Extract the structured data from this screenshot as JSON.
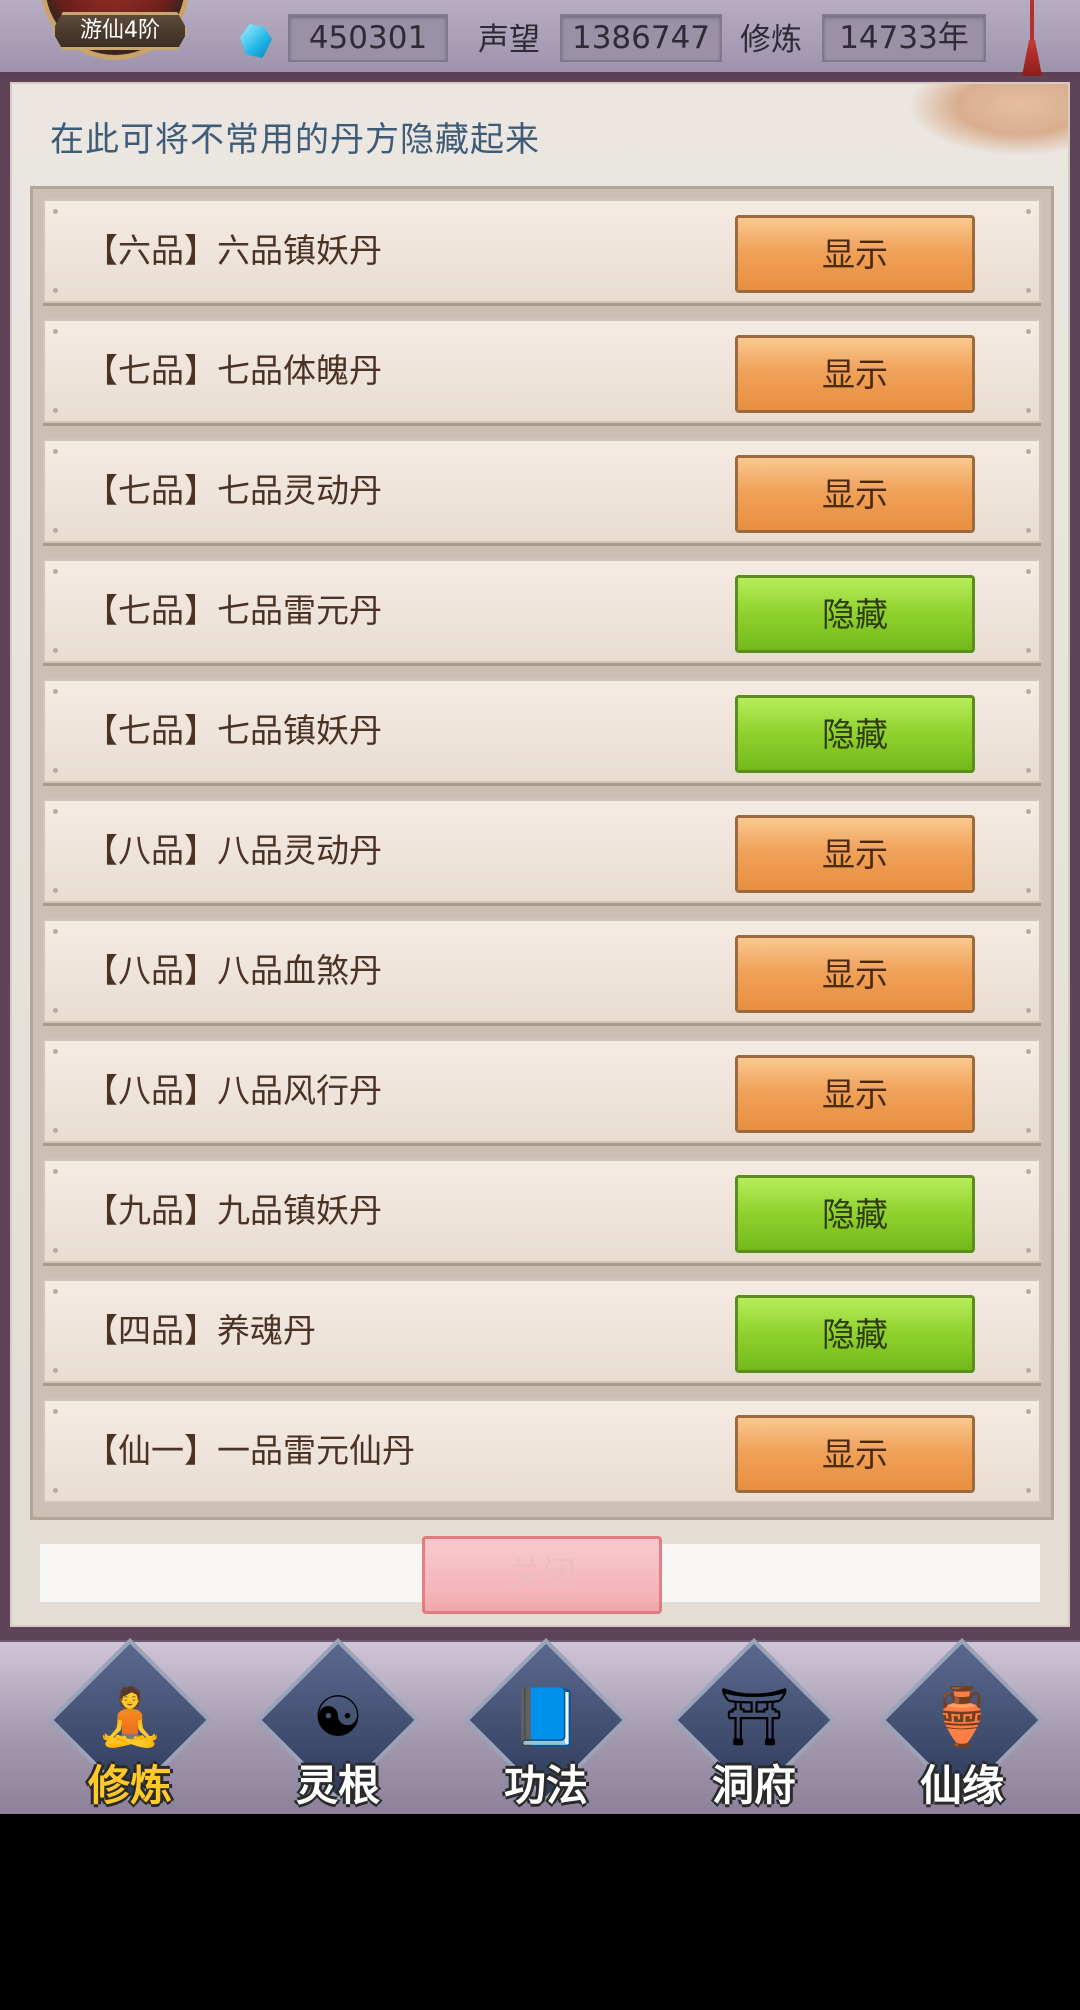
{
  "header": {
    "level_badge": "游仙4阶",
    "gems": "450301",
    "reputation_label": "声望",
    "reputation_value": "1386747",
    "cultivation_label": "修炼",
    "cultivation_value": "14733年"
  },
  "dialog": {
    "hint": "在此可将不常用的丹方隐藏起来",
    "close_label": "关闭",
    "rows": [
      {
        "grade": "【六品】",
        "name": "六品镇妖丹",
        "action": "显示",
        "state": "show"
      },
      {
        "grade": "【七品】",
        "name": "七品体魄丹",
        "action": "显示",
        "state": "show"
      },
      {
        "grade": "【七品】",
        "name": "七品灵动丹",
        "action": "显示",
        "state": "show"
      },
      {
        "grade": "【七品】",
        "name": "七品雷元丹",
        "action": "隐藏",
        "state": "hide"
      },
      {
        "grade": "【七品】",
        "name": "七品镇妖丹",
        "action": "隐藏",
        "state": "hide"
      },
      {
        "grade": "【八品】",
        "name": "八品灵动丹",
        "action": "显示",
        "state": "show"
      },
      {
        "grade": "【八品】",
        "name": "八品血煞丹",
        "action": "显示",
        "state": "show"
      },
      {
        "grade": "【八品】",
        "name": "八品风行丹",
        "action": "显示",
        "state": "show"
      },
      {
        "grade": "【九品】",
        "name": "九品镇妖丹",
        "action": "隐藏",
        "state": "hide"
      },
      {
        "grade": "【四品】",
        "name": "养魂丹",
        "action": "隐藏",
        "state": "hide"
      },
      {
        "grade": "【仙一】",
        "name": "一品雷元仙丹",
        "action": "显示",
        "state": "show"
      }
    ]
  },
  "nav": {
    "items": [
      {
        "label": "修炼",
        "icon": "hooded-cultivator-icon",
        "active": true
      },
      {
        "label": "灵根",
        "icon": "yin-yang-sword-icon",
        "active": false
      },
      {
        "label": "功法",
        "icon": "scripture-book-icon",
        "active": false
      },
      {
        "label": "洞府",
        "icon": "pavilion-icon",
        "active": false
      },
      {
        "label": "仙缘",
        "icon": "gourd-icon",
        "active": false
      }
    ]
  }
}
